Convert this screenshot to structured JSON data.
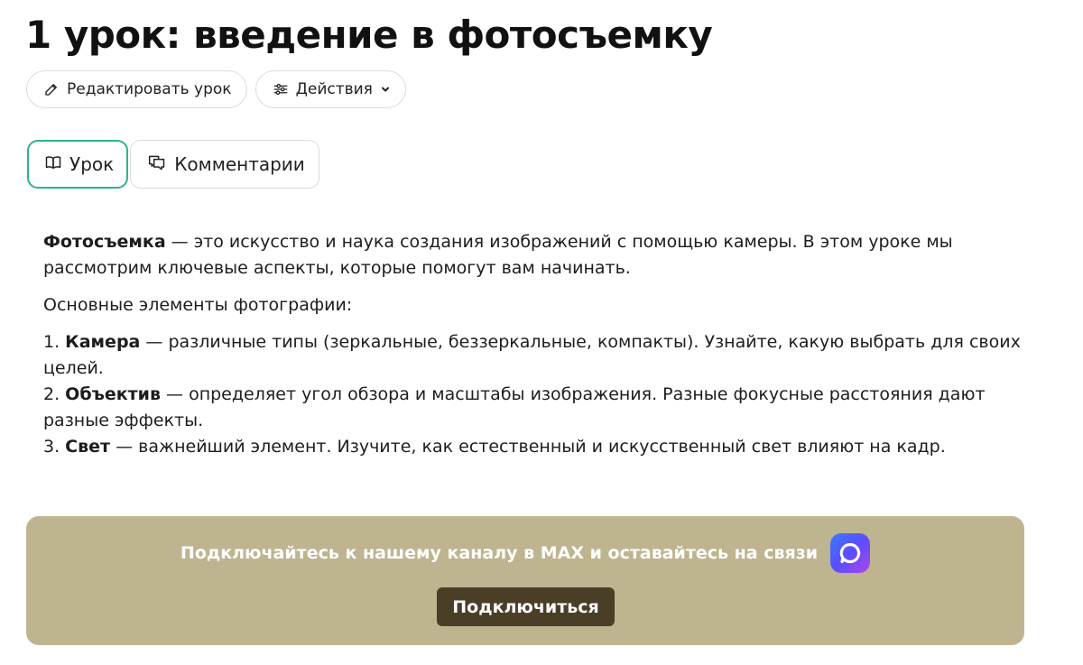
{
  "page": {
    "title": "1 урок: введение в фотосъемку"
  },
  "toolbar": {
    "edit_label": "Редактировать урок",
    "actions_label": "Действия"
  },
  "tabs": [
    {
      "label": "Урок",
      "active": true,
      "icon": "book-icon"
    },
    {
      "label": "Комментарии",
      "active": false,
      "icon": "chat-icon"
    }
  ],
  "content": {
    "intro_term": "Фотосъемка",
    "intro_rest": " — это искусство и наука создания изображений с помощью камеры. В этом уроке мы рассмотрим ключевые аспекты, которые помогут вам начинать.",
    "list_heading": "Основные элементы фотографии:",
    "items": [
      {
        "prefix": "1. ",
        "term": "Камера",
        "rest": " — различные типы (зеркальные, беззеркальные, компакты). Узнайте, какую выбрать для своих целей."
      },
      {
        "prefix": "2. ",
        "term": "Объектив",
        "rest": " — определяет угол обзора и масштабы изображения. Разные фокусные расстояния дают разные эффекты."
      },
      {
        "prefix": "3. ",
        "term": "Свет",
        "rest": " — важнейший элемент. Изучите, как естественный и искусственный свет влияют на кадр."
      }
    ]
  },
  "banner": {
    "text": "Подключайтесь к нашему каналу в MAX и оставайтесь на связи",
    "button_label": "Подключиться",
    "logo_icon": "max-logo-icon",
    "background_color": "#beb48f",
    "button_color": "#4b3e27"
  },
  "colors": {
    "active_tab_border": "#2bb58a"
  }
}
